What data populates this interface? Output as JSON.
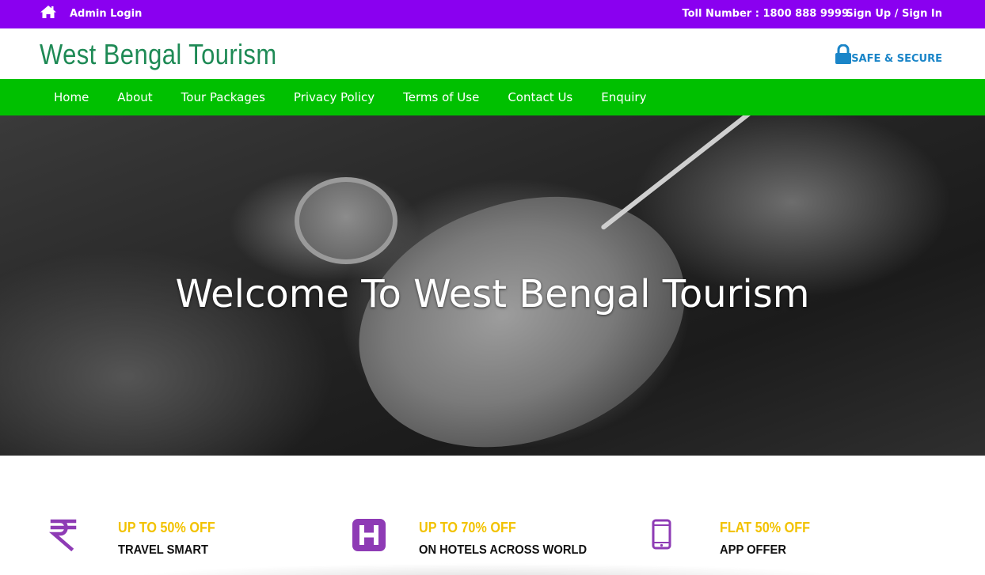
{
  "topbar": {
    "admin_login": "Admin Login",
    "toll_number": "Toll Number : 1800 888 9999",
    "signup": "Sign Up / Sign In",
    "bg_color": "#8a00f0",
    "icon": "home-icon"
  },
  "header": {
    "brand": "West Bengal Tourism",
    "secure_label": "SAFE & SECURE",
    "secure_icon": "lock-icon",
    "brand_color": "#1e8a55"
  },
  "nav": {
    "bg_color": "#00c000",
    "items": [
      {
        "label": "Home"
      },
      {
        "label": "About"
      },
      {
        "label": "Tour Packages"
      },
      {
        "label": "Privacy Policy"
      },
      {
        "label": "Terms of Use"
      },
      {
        "label": "Contact Us"
      },
      {
        "label": "Enquiry"
      }
    ]
  },
  "hero": {
    "title": "Welcome To West Bengal Tourism"
  },
  "features": [
    {
      "icon": "rupee-icon",
      "deal": "UP TO 50% OFF",
      "sub": "TRAVEL SMART"
    },
    {
      "icon": "hotel-icon",
      "deal": "UP TO 70% OFF",
      "sub": "ON HOTELS ACROSS WORLD"
    },
    {
      "icon": "mobile-icon",
      "deal": "FLAT 50% OFF",
      "sub": "APP OFFER"
    }
  ],
  "accent_colors": {
    "icon_purple": "#8e3bb5",
    "deal_yellow": "#f2c200",
    "secure_blue": "#1a85c8"
  }
}
